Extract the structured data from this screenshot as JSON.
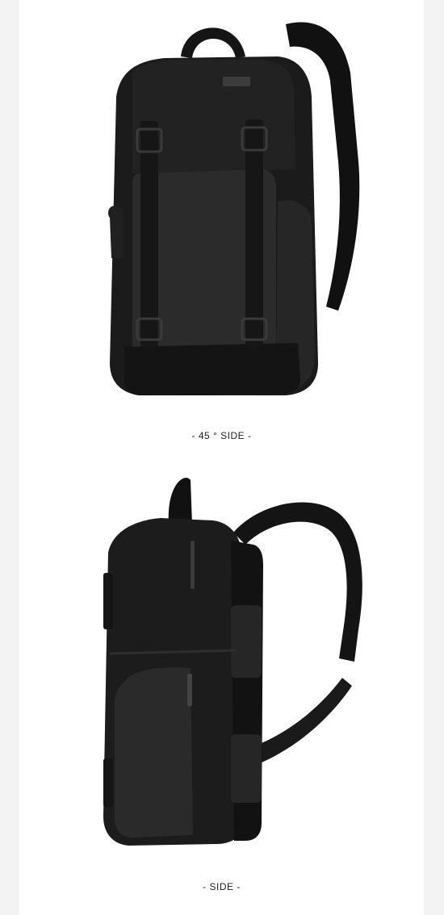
{
  "captions": {
    "front_angle": "- 45 ° SIDE -",
    "side": "- SIDE -"
  },
  "images": {
    "front_angle_icon": "backpack-45-degree-view",
    "side_icon": "backpack-side-view"
  },
  "colors": {
    "page_background": "#ffffff",
    "outer_background": "#f3f3f3",
    "bag_body": "#1a1a1a",
    "bag_panel": "#2b2b2b",
    "strap": "#111111"
  }
}
